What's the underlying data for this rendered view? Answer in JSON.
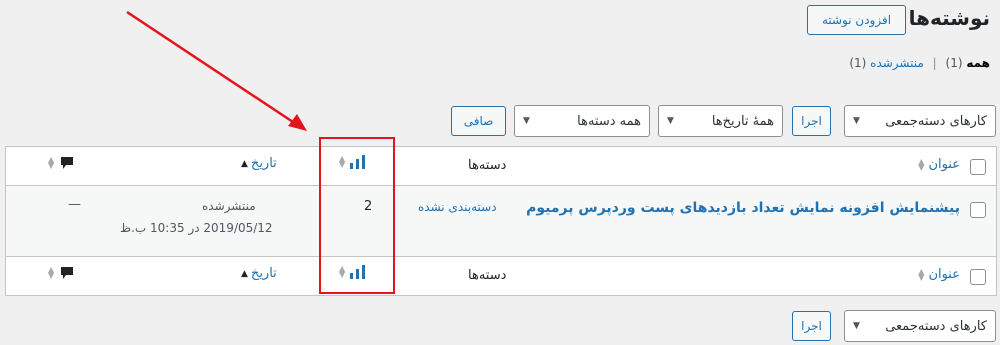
{
  "header": {
    "title": "نوشته‌ها",
    "add_new_label": "افزودن نوشته"
  },
  "views": {
    "all_label": "همه",
    "all_count": "(1)",
    "separator": "|",
    "published_label": "منتشرشده",
    "published_count": "(1)"
  },
  "top_actions": {
    "bulk_actions": "کارهای دسته‌جمعی",
    "apply_label": "اجرا",
    "all_dates": "همهٔ تاریخ‌ها",
    "all_categories": "همه دسته‌ها",
    "filter_label": "صافی"
  },
  "table": {
    "columns": {
      "title": "عنوان",
      "categories": "دسته‌ها",
      "date": "تاریخ"
    },
    "rows": [
      {
        "title": "پیشنمایش افزونه نمایش تعداد بازدیدهای پست وردپرس پرمیوم",
        "category": "دسته‌بندی نشده",
        "views": "2",
        "status": "منتشرشده",
        "date": "2019/05/12 در 10:35 ب.ظ",
        "comments": "—"
      }
    ]
  },
  "bottom_actions": {
    "bulk_actions": "کارهای دسته‌جمعی",
    "apply_label": "اجرا"
  },
  "colors": {
    "accent": "#2271b1",
    "annotation": "#e4141b",
    "border": "#c3c4c7",
    "background": "#f0f0f1"
  },
  "icons": {
    "views_column": "bar-chart-icon",
    "comments_column": "comment-bubble-icon",
    "sort": "sort-arrows-icon"
  }
}
